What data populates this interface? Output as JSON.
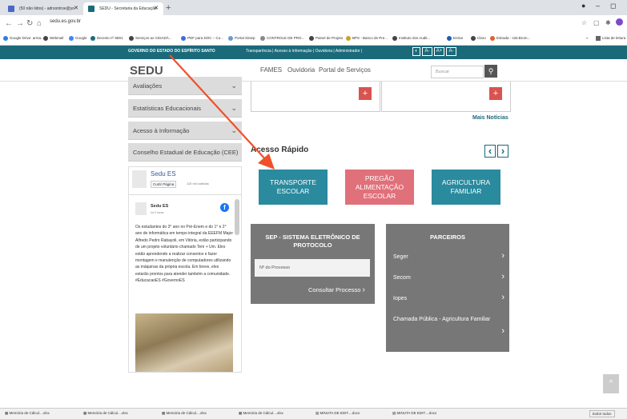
{
  "browser": {
    "tabs": [
      {
        "label": "(50 não lidos) - adrsontroe@yo",
        "color": "#4a67c9"
      },
      {
        "label": "SEDU - Secretaria da Educação",
        "color": "#1b6a7a"
      }
    ],
    "new_tab": "+",
    "url": "sedu.es.gov.br",
    "bookmarks": [
      "Google Drive: arma...",
      "Webmail",
      "Google",
      "Decreto nº 8691",
      "Serviços ao CIDADÃ...",
      "PDF para DOC – Co...",
      "Portal Siniep",
      "CONTROLE DE PRO...",
      "Painel de Projeto",
      "BPS - Banco de Pre...",
      "Instituto dos Audit...",
      "Entrar",
      "Claro",
      "Estrada - sist-Brom..."
    ],
    "bookmarks_more": "»",
    "reading_list": "Lista de leitura"
  },
  "gov_bar": {
    "title": "GOVERNO DO ESTADO DO ESPÍRITO SANTO",
    "links": "Transparência | Acesso à Informação | Ouvidoria | Administrador |",
    "acc": [
      "A-",
      "A+",
      "A-"
    ]
  },
  "header": {
    "logo": "SEDU",
    "nav": [
      "FAMES",
      "Ouvidoria",
      "Portal de Serviços"
    ],
    "search_placeholder": "Buscar",
    "search_icon": "search-icon"
  },
  "sidebar": {
    "items": [
      "Avaliações",
      "Estatísticas Educacionais",
      "Acesso à Informação",
      "Conselho Estadual de Educação (CEE)"
    ]
  },
  "facebook": {
    "page_name": "Sedu ES",
    "like_label": "Curtir Página",
    "likes": "115 mil curtidas",
    "post_author": "Sedu ES",
    "post_time": "há 3 horas",
    "post_text": "Os estudantes do 3° ano no Pré-Enem e do 1° e 2° ano de informática em tempo integral da EEEFM Major Alfredo Pedro Rabayoli, em Vitória, estão participando de um projeto voluntário chamado Tem + Um. Eles estão aprendendo a realizar consertos e fazer montagem e manutenção de computadores utilizando as máquinas da própria escola. Em breve, eles estarão prontos para atender também a comunidade. #EducacaoES #GovernoES"
  },
  "news": {
    "more": "Mais Notícias",
    "plus": "+"
  },
  "quick_access": {
    "title": "Acesso Rápido",
    "prev": "‹",
    "next": "›",
    "buttons": [
      {
        "label": "TRANSPORTE ESCOLAR",
        "color": "#2a8a9e"
      },
      {
        "label": "PREGÃO ALIMENTAÇÃO ESCOLAR",
        "color": "#e0707a"
      },
      {
        "label": "AGRICULTURA FAMILIAR",
        "color": "#2a8a9e"
      }
    ]
  },
  "sep": {
    "title": "SEP - SISTEMA ELETRÔNICO DE PROTOCOLO",
    "field_placeholder": "Nº do Processo",
    "consult": "Consultar Processo"
  },
  "partners": {
    "title": "PARCEIROS",
    "items": [
      "Seger",
      "Secom",
      "Iopes",
      "Chamada Pública - Agricultura Familiar"
    ]
  },
  "downloads": [
    "Memória de Cálcul....xlsx",
    "Memória de Cálcul....xlsx",
    "Memória de Cálcul....xlsx",
    "Memória de Cálcul....xlsx",
    "MINUTA DE EDIT....docx",
    "MINUTA DE EDIT....docx"
  ],
  "downloads_all": "Exibir todos",
  "scroll_top": "^",
  "colors": {
    "gov_bar": "#1b6a7a",
    "arrow": "#f0502a",
    "teal": "#2a8a9e",
    "pink": "#e0707a",
    "gray_box": "#777777"
  }
}
